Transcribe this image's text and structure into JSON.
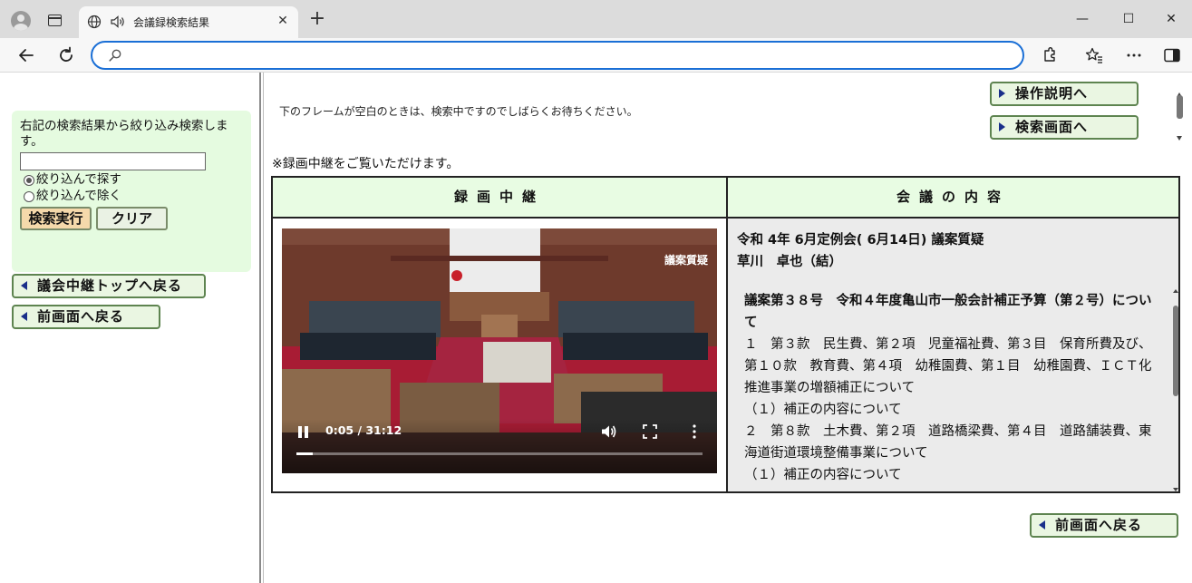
{
  "browser": {
    "tab_title": "会議録検索結果",
    "tab_close": "✕",
    "new_tab": "+",
    "url": "",
    "controls": {
      "minimize": "—",
      "maximize": "☐",
      "close": "✕"
    },
    "icons": [
      "profile-icon",
      "tab-actions-icon",
      "globe-icon",
      "speaker-icon",
      "back-icon",
      "refresh-icon",
      "search-icon",
      "extensions-icon",
      "favorites-icon",
      "more-icon",
      "sidebar-icon"
    ]
  },
  "left": {
    "filter_label": "右記の検索結果から絞り込み検索します。",
    "filter_input_value": "",
    "radio_narrow": "絞り込んで探す",
    "radio_exclude": "絞り込んで除く",
    "radio_selected": "narrow",
    "search_button": "検索実行",
    "clear_button": "クリア",
    "top_button": "議会中継トップへ戻る",
    "back_button": "前画面へ戻る"
  },
  "right": {
    "manual_button": "操作説明へ",
    "search_screen_button": "検索画面へ",
    "wait_note": "下のフレームが空白のときは、検索中ですのでしばらくお待ちください。",
    "recording_note": "※録画中継をご覧いただけます。",
    "col_recording": "録画中継",
    "col_content": "会議の内容",
    "video": {
      "caption": "議案質疑",
      "time": "0:05 / 31:12",
      "progress_fraction": 0.04
    },
    "meeting_title": "令和 4年 6月定例会( 6月14日)  議案質疑",
    "speaker": "草川　卓也（結）",
    "agenda_title": "議案第３８号　令和４年度亀山市一般会計補正予算（第２号）について",
    "agenda_items": [
      "１　第３款　民生費、第２項　児童福祉費、第３目　保育所費及び、第１０款　教育費、第４項　幼稚園費、第１目　幼稚園費、ＩＣＴ化推進事業の増額補正について",
      "（１）補正の内容について",
      "２　第８款　土木費、第２項　道路橋梁費、第４目　道路舗装費、東海道街道環境整備事業について",
      "（１）補正の内容について"
    ],
    "bottom_back_button": "前画面へ戻る"
  },
  "colors": {
    "accent_blue": "#1a6fd6",
    "header_green": "#e8fce3",
    "panel_green": "#e5fbe0",
    "button_border": "#5e8450",
    "search_button_bg": "#f5d9ab"
  }
}
